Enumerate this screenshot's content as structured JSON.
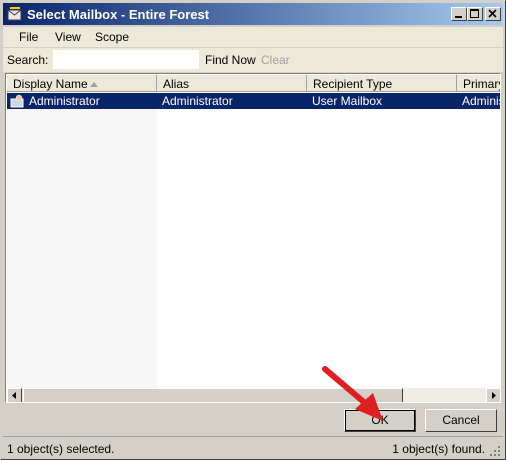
{
  "window": {
    "title": "Select Mailbox - Entire Forest"
  },
  "menu": {
    "file": "File",
    "view": "View",
    "scope": "Scope"
  },
  "search": {
    "label": "Search:",
    "value": "",
    "find_now": "Find Now",
    "clear": "Clear"
  },
  "list": {
    "columns": [
      "Display Name",
      "Alias",
      "Recipient Type",
      "Primary"
    ],
    "rows": [
      {
        "display_name": "Administrator",
        "alias": "Administrator",
        "recipient_type": "User Mailbox",
        "primary": "Administ"
      }
    ]
  },
  "buttons": {
    "ok": "OK",
    "cancel": "Cancel"
  },
  "status": {
    "selected": "1 object(s) selected.",
    "found": "1 object(s) found."
  },
  "colors": {
    "titlebar": "#0a246a",
    "selection": "#0a246a",
    "annotation_arrow": "#e02020"
  }
}
